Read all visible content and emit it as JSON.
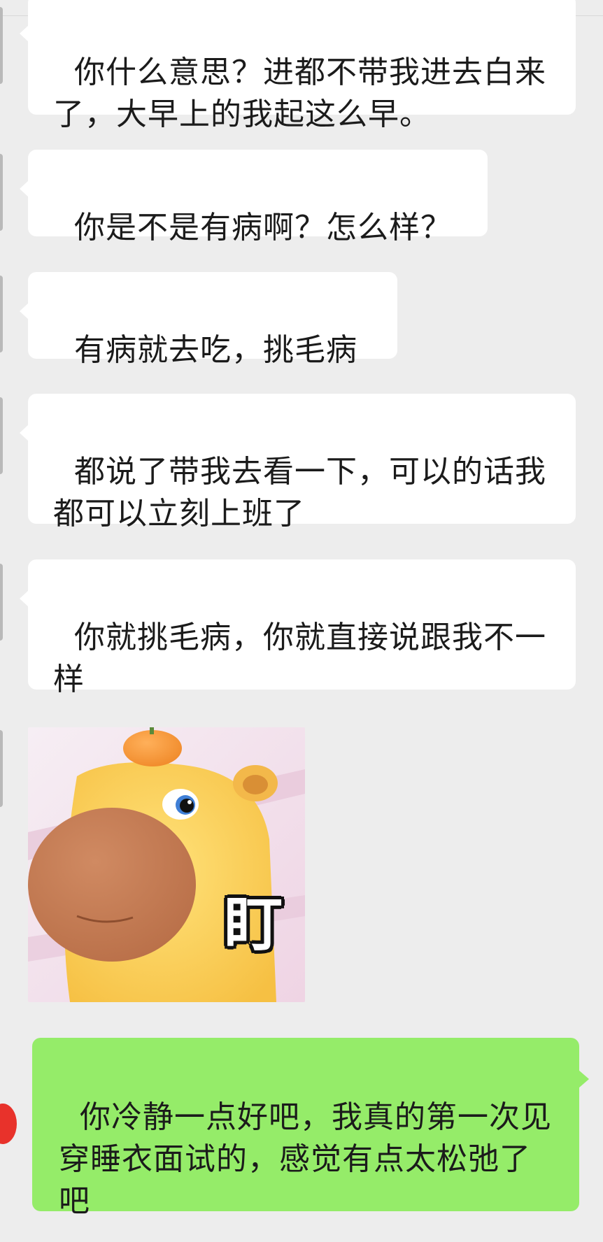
{
  "chat": {
    "messages": [
      {
        "side": "incoming",
        "text": "你什么意思？进都不带我进去白来了，大早上的我起这么早。"
      },
      {
        "side": "incoming",
        "text": "你是不是有病啊？怎么样？"
      },
      {
        "side": "incoming",
        "text": "有病就去吃，挑毛病"
      },
      {
        "side": "incoming",
        "text": "都说了带我去看一下，可以的话我都可以立刻上班了"
      },
      {
        "side": "incoming",
        "text": "你就挑毛病，你就直接说跟我不一样"
      },
      {
        "side": "outgoing",
        "text": "你冷静一点好吧，我真的第一次见穿睡衣面试的，感觉有点太松弛了吧"
      }
    ],
    "sticker": {
      "caption": "盯",
      "icon": "capybara-sticker-icon"
    }
  },
  "colors": {
    "background": "#ededed",
    "incoming_bubble": "#ffffff",
    "outgoing_bubble": "#95ec69",
    "text": "#1b1b1b"
  }
}
